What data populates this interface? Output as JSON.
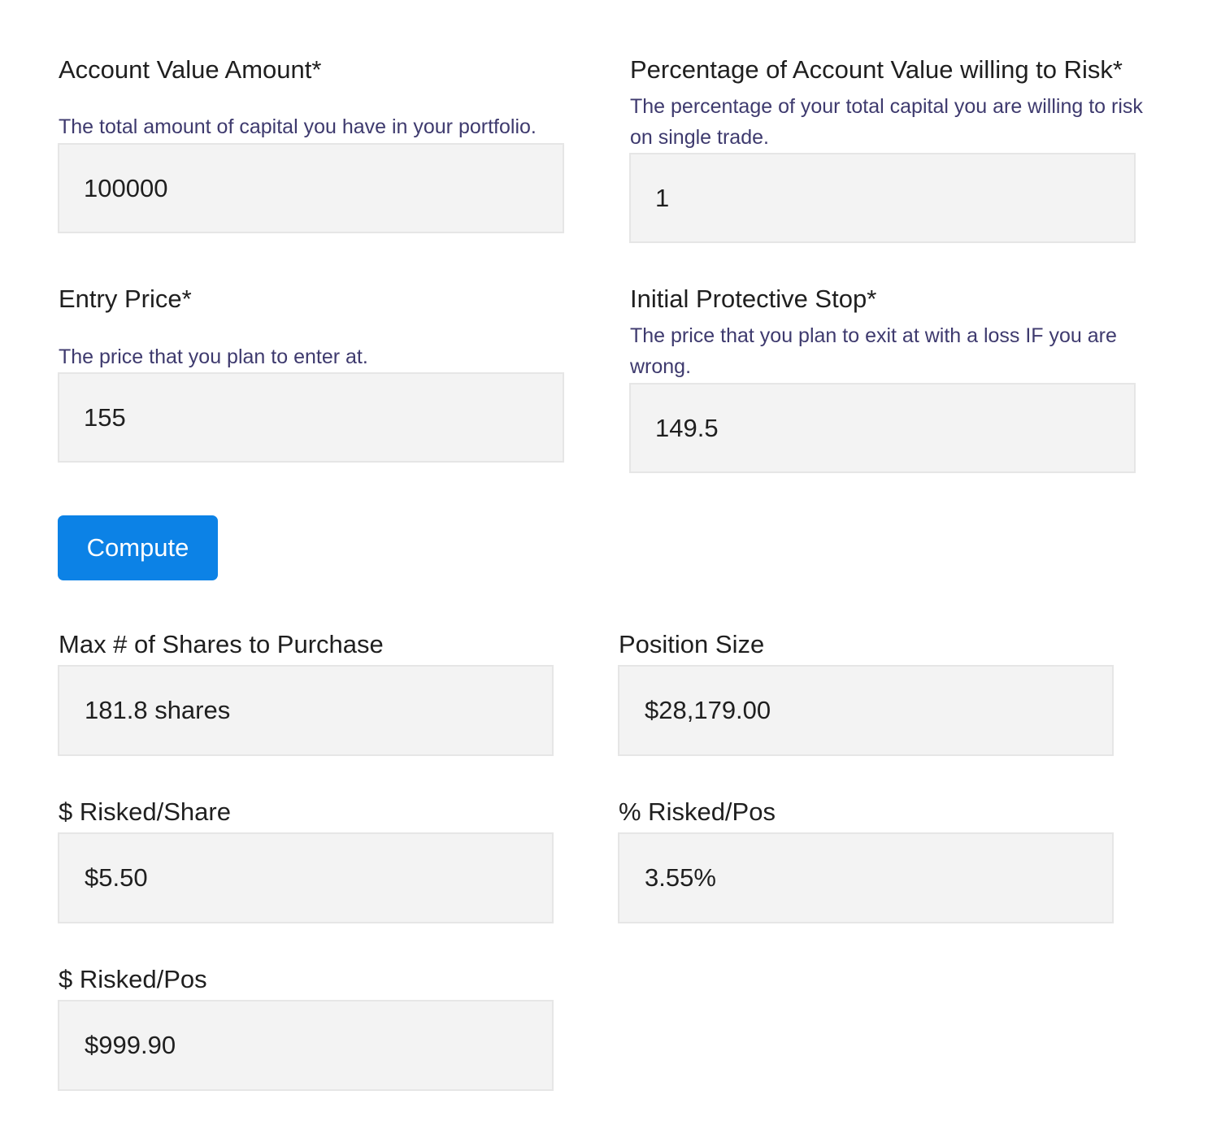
{
  "inputs": {
    "account_value": {
      "label": "Account Value Amount*",
      "help": "The total amount of capital you have in your portfolio.",
      "value": "100000"
    },
    "risk_percentage": {
      "label": "Percentage of Account Value willing to Risk*",
      "help": "The percentage of your total capital you are willing to risk on single trade.",
      "value": "1"
    },
    "entry_price": {
      "label": "Entry Price*",
      "help": "The price that you plan to enter at.",
      "value": "155"
    },
    "protective_stop": {
      "label": "Initial Protective Stop*",
      "help": "The price that you plan to exit at with a loss IF you are wrong.",
      "value": "149.5"
    }
  },
  "actions": {
    "compute_label": "Compute",
    "compute_color": "#0c82e6"
  },
  "results": {
    "max_shares": {
      "label": "Max # of Shares to Purchase",
      "value": "181.8 shares"
    },
    "position_size": {
      "label": "Position Size",
      "value": "$28,179.00"
    },
    "risked_per_share": {
      "label": "$ Risked/Share",
      "value": "$5.50"
    },
    "pct_risked_per_pos": {
      "label": "% Risked/Pos",
      "value": "3.55%"
    },
    "risked_per_pos": {
      "label": "$ Risked/Pos",
      "value": "$999.90"
    }
  },
  "colors": {
    "help_text": "#3e3a6e",
    "field_background": "#f3f3f3",
    "field_border": "#e6e6e6",
    "text": "#1f1f1f"
  }
}
